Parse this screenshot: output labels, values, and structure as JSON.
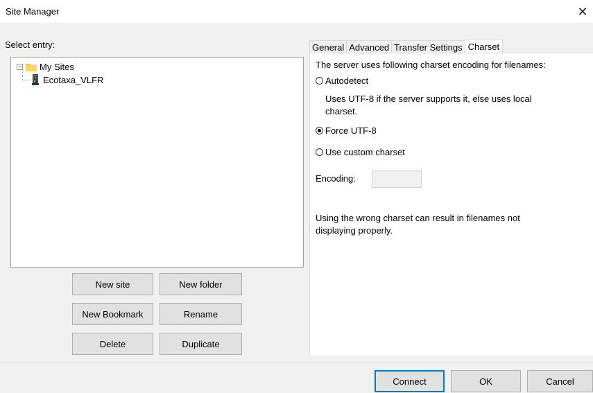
{
  "window": {
    "title": "Site Manager",
    "close_glyph": "✕"
  },
  "left": {
    "select_label": "Select entry:",
    "tree": {
      "root": {
        "label": "My Sites",
        "expander": "−",
        "icon": "folder-icon"
      },
      "child": {
        "label": "Ecotaxa_VLFR",
        "icon": "server-icon"
      }
    },
    "buttons": {
      "new_site": "New site",
      "new_folder": "New folder",
      "new_bookmark": "New Bookmark",
      "rename": "Rename",
      "delete": "Delete",
      "duplicate": "Duplicate"
    }
  },
  "tabs": [
    {
      "label": "General"
    },
    {
      "label": "Advanced"
    },
    {
      "label": "Transfer Settings"
    },
    {
      "label": "Charset",
      "active": true
    }
  ],
  "charset": {
    "intro": "The server uses following charset encoding for filenames:",
    "autodetect_label": "Autodetect",
    "autodetect_desc_line1": "Uses UTF-8 if the server supports it, else uses local",
    "autodetect_desc_line2": "charset.",
    "force_utf8_label": "Force UTF-8",
    "custom_label": "Use custom charset",
    "selected": "Force UTF-8",
    "encoding_label": "Encoding:",
    "encoding_value": "",
    "warning_line1": "Using the wrong charset can result in filenames not",
    "warning_line2": "displaying properly."
  },
  "footer": {
    "connect": "Connect",
    "ok": "OK",
    "cancel": "Cancel"
  },
  "colors": {
    "accent": "#0078d7",
    "folder": "#f4c542"
  }
}
